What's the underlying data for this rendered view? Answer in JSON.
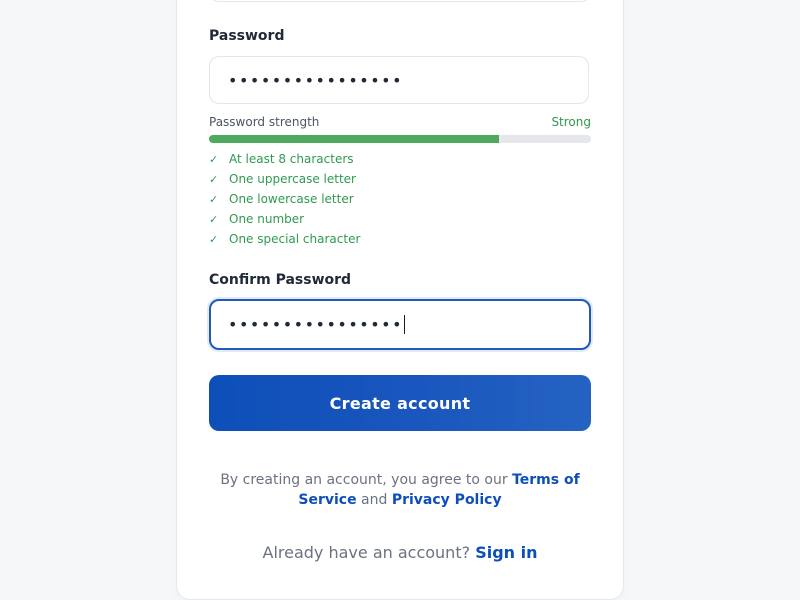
{
  "password": {
    "label": "Password",
    "value": "••••••••••••••••"
  },
  "strength": {
    "label": "Password strength",
    "value": "Strong",
    "level": 0.76
  },
  "requirements": [
    {
      "icon": "check-icon",
      "text": "At least 8 characters"
    },
    {
      "icon": "check-icon",
      "text": "One uppercase letter"
    },
    {
      "icon": "check-icon",
      "text": "One lowercase letter"
    },
    {
      "icon": "check-icon",
      "text": "One number"
    },
    {
      "icon": "check-icon",
      "text": "One special character"
    }
  ],
  "confirm": {
    "label": "Confirm Password",
    "value": "••••••••••••••••"
  },
  "submit": {
    "label": "Create account"
  },
  "terms": {
    "prefix": "By creating an account, you agree to our",
    "terms_link": "Terms of Service",
    "conjunction": "and",
    "privacy_link": "Privacy Policy"
  },
  "signin": {
    "prompt": "Already have an account?",
    "link": "Sign in"
  },
  "colors": {
    "accent": "#0d4fb9",
    "success": "#2f9a50",
    "strength_bar": "#4caa5c"
  }
}
